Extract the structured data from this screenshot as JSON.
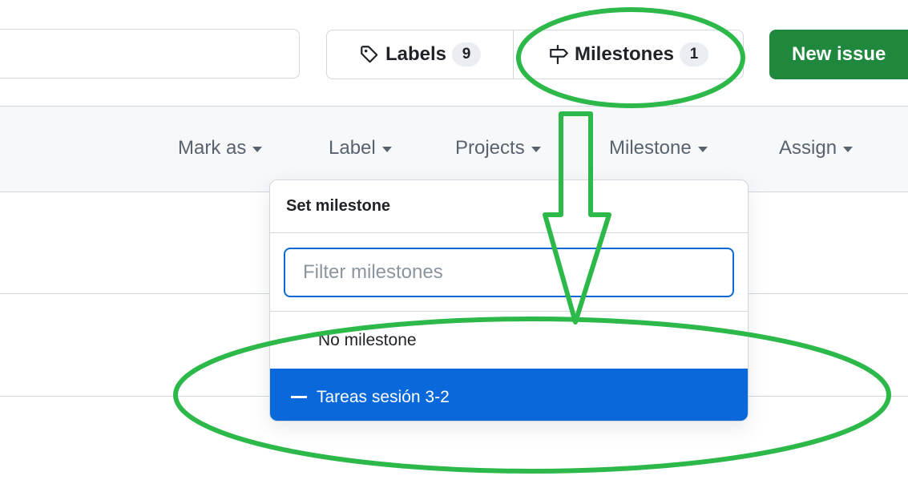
{
  "toolbar": {
    "labels": {
      "label": "Labels",
      "count": "9"
    },
    "milestones": {
      "label": "Milestones",
      "count": "1"
    },
    "new_issue": "New issue"
  },
  "filters": [
    "Mark as",
    "Label",
    "Projects",
    "Milestone",
    "Assign"
  ],
  "dropdown": {
    "title": "Set milestone",
    "filter_placeholder": "Filter milestones",
    "items": [
      "No milestone",
      "Tareas sesión 3-2"
    ],
    "selected": "Tareas sesión 3-2"
  },
  "annotation": {
    "color": "#2db84a"
  },
  "colors": {
    "primary_green": "#1f883d",
    "accent_blue": "#0969da"
  }
}
